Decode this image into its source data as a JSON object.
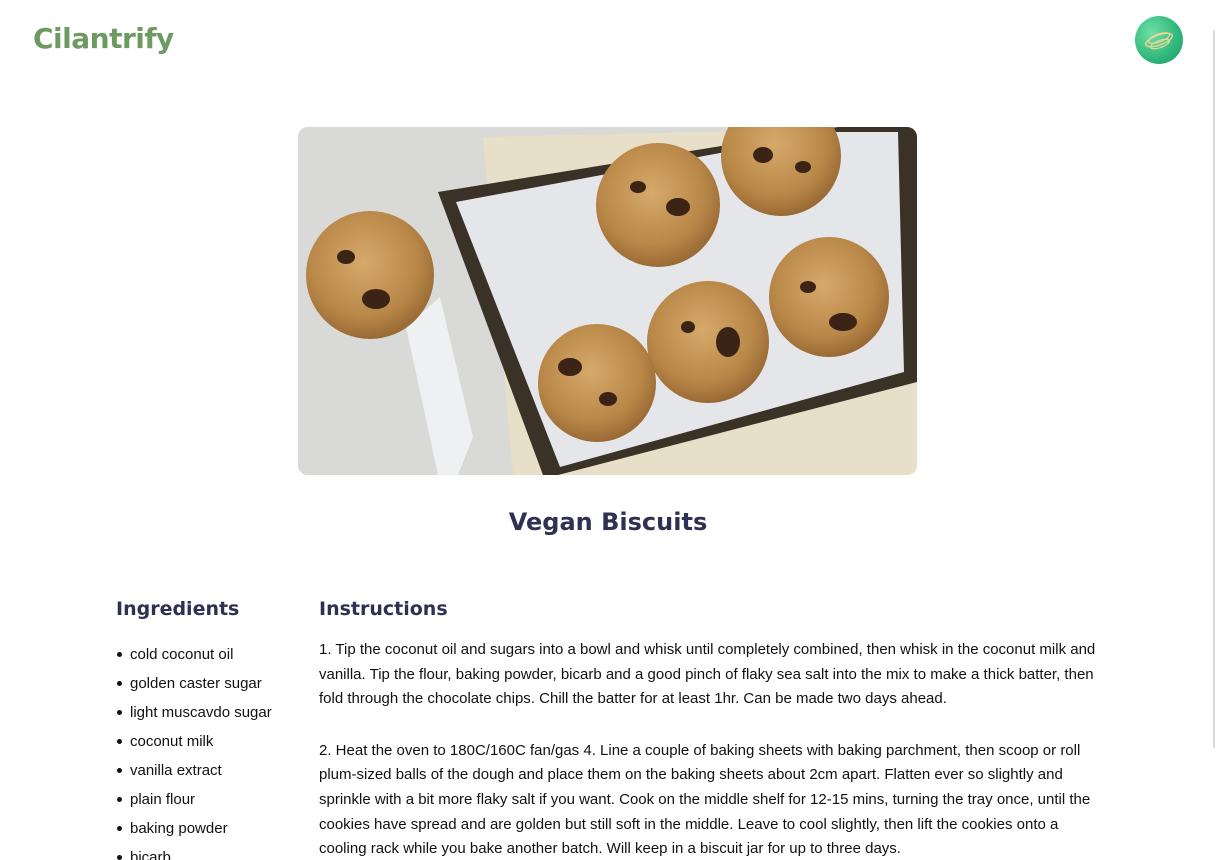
{
  "header": {
    "logo": "Cilantrify",
    "avatar_icon": "globe-avatar-icon",
    "brand_color": "#6e9a62",
    "avatar_color": "#2fb67a"
  },
  "recipe": {
    "image_alt": "chocolate chip cookies on a baking tray",
    "title": "Vegan Biscuits",
    "ingredients_heading": "Ingredients",
    "ingredients": [
      "cold coconut oil",
      "golden caster sugar",
      "light muscavdo sugar",
      "coconut milk",
      "vanilla extract",
      "plain flour",
      "baking powder",
      "bicarb"
    ],
    "instructions_heading": "Instructions",
    "instructions": [
      "1. Tip the coconut oil and sugars into a bowl and whisk until completely combined, then whisk in the coconut milk and vanilla. Tip the flour, baking powder, bicarb and a good pinch of flaky sea salt into the mix to make a thick batter, then fold through the chocolate chips. Chill the batter for at least 1hr. Can be made two days ahead.",
      "2. Heat the oven to 180C/160C fan/gas 4. Line a couple of baking sheets with baking parchment, then scoop or roll plum-sized balls of the dough and place them on the baking sheets about 2cm apart. Flatten ever so slightly and sprinkle with a bit more flaky salt if you want. Cook on the middle shelf for 12-15 mins, turning the tray once, until the cookies have spread and are golden but still soft in the middle. Leave to cool slightly, then lift the cookies onto a cooling rack while you bake another batch. Will keep in a biscuit jar for up to three days."
    ],
    "heading_color": "#2e3151"
  }
}
